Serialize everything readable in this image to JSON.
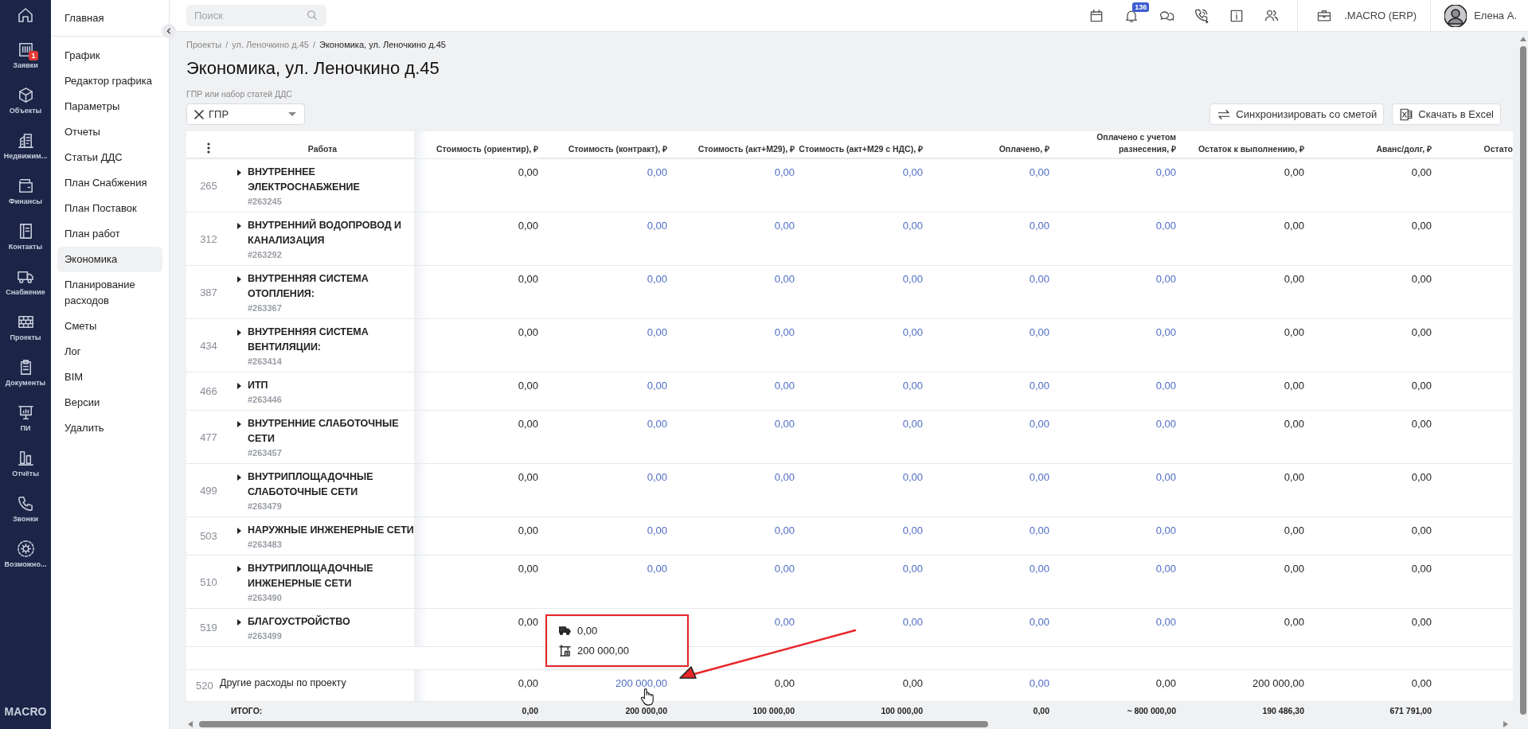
{
  "rail": {
    "items": [
      {
        "label": "Заявки",
        "badge": "1"
      },
      {
        "label": "Объекты"
      },
      {
        "label": "Недвижим..."
      },
      {
        "label": "Финансы"
      },
      {
        "label": "Контакты"
      },
      {
        "label": "Снабжение"
      },
      {
        "label": "Проекты"
      },
      {
        "label": "Документы"
      },
      {
        "label": "ПИ"
      },
      {
        "label": "Отчёты"
      },
      {
        "label": "Звонки"
      },
      {
        "label": "Возможно..."
      }
    ],
    "brand": "MACRO"
  },
  "sidebar": {
    "title": "Главная",
    "items": [
      {
        "label": "График",
        "selected": false
      },
      {
        "label": "Редактор графика",
        "selected": false
      },
      {
        "label": "Параметры",
        "selected": false
      },
      {
        "label": "Отчеты",
        "selected": false
      },
      {
        "label": "Статьи ДДС",
        "selected": false
      },
      {
        "label": "План Снабжения",
        "selected": false
      },
      {
        "label": "План Поставок",
        "selected": false
      },
      {
        "label": "План работ",
        "selected": false
      },
      {
        "label": "Экономика",
        "selected": true
      },
      {
        "label": "Планирование расходов",
        "selected": false
      },
      {
        "label": "Сметы",
        "selected": false
      },
      {
        "label": "Лог",
        "selected": false
      },
      {
        "label": "BIM",
        "selected": false
      },
      {
        "label": "Версии",
        "selected": false
      },
      {
        "label": "Удалить",
        "selected": false
      }
    ]
  },
  "topbar": {
    "search": {
      "placeholder": "Поиск"
    },
    "notifications_count": "136",
    "company": ".MACRO (ERP)",
    "user": "Елена А."
  },
  "breadcrumbs": [
    "Проекты",
    "ул. Леночкино д.45",
    "Экономика, ул. Леночкино д.45"
  ],
  "breadcrumb_separator": "/",
  "page_title": "Экономика, ул. Леночкино д.45",
  "filter": {
    "label": "ГПР или набор статей ДДС",
    "value": "ГПР"
  },
  "actions": [
    "Синхронизировать со сметой",
    "Скачать в Excel"
  ],
  "table": {
    "columns": [
      "Работа",
      "Стоимость (ориентир), ₽",
      "Стоимость (контракт), ₽",
      "Стоимость (акт+М29), ₽",
      "Стоимость (акт+М29 с НДС), ₽",
      "Оплачено, ₽",
      "Оплачено с учетом разнесения, ₽",
      "Остаток к выполнению, ₽",
      "Аванс/долг, ₽",
      "Остато"
    ],
    "rows": [
      {
        "kind": "group",
        "number": "265",
        "name": "ВНУТРЕННЕЕ ЭЛЕКТРОСНАБЖЕНИЕ",
        "code": "#263245",
        "cells": [
          {
            "value": "0,00",
            "link": false
          },
          {
            "value": "0,00",
            "link": true
          },
          {
            "value": "0,00",
            "link": true
          },
          {
            "value": "0,00",
            "link": true
          },
          {
            "value": "0,00",
            "link": true
          },
          {
            "value": "0,00",
            "link": true
          },
          {
            "value": "0,00",
            "link": false
          },
          {
            "value": "0,00",
            "link": false
          }
        ]
      },
      {
        "kind": "group",
        "number": "312",
        "name": "ВНУТРЕННИЙ ВОДОПРОВОД И КАНАЛИЗАЦИЯ",
        "code": "#263292",
        "cells": [
          {
            "value": "0,00",
            "link": false
          },
          {
            "value": "0,00",
            "link": true
          },
          {
            "value": "0,00",
            "link": true
          },
          {
            "value": "0,00",
            "link": true
          },
          {
            "value": "0,00",
            "link": true
          },
          {
            "value": "0,00",
            "link": true
          },
          {
            "value": "0,00",
            "link": false
          },
          {
            "value": "0,00",
            "link": false
          }
        ]
      },
      {
        "kind": "group",
        "number": "387",
        "name": "ВНУТРЕННЯЯ СИСТЕМА ОТОПЛЕНИЯ:",
        "code": "#263367",
        "cells": [
          {
            "value": "0,00",
            "link": false
          },
          {
            "value": "0,00",
            "link": true
          },
          {
            "value": "0,00",
            "link": true
          },
          {
            "value": "0,00",
            "link": true
          },
          {
            "value": "0,00",
            "link": true
          },
          {
            "value": "0,00",
            "link": true
          },
          {
            "value": "0,00",
            "link": false
          },
          {
            "value": "0,00",
            "link": false
          }
        ]
      },
      {
        "kind": "group",
        "number": "434",
        "name": "ВНУТРЕННЯЯ СИСТЕМА ВЕНТИЛЯЦИИ:",
        "code": "#263414",
        "cells": [
          {
            "value": "0,00",
            "link": false
          },
          {
            "value": "0,00",
            "link": true
          },
          {
            "value": "0,00",
            "link": true
          },
          {
            "value": "0,00",
            "link": true
          },
          {
            "value": "0,00",
            "link": true
          },
          {
            "value": "0,00",
            "link": true
          },
          {
            "value": "0,00",
            "link": false
          },
          {
            "value": "0,00",
            "link": false
          }
        ]
      },
      {
        "kind": "group",
        "number": "466",
        "name": "ИТП",
        "code": "#263446",
        "cells": [
          {
            "value": "0,00",
            "link": false
          },
          {
            "value": "0,00",
            "link": true
          },
          {
            "value": "0,00",
            "link": true
          },
          {
            "value": "0,00",
            "link": true
          },
          {
            "value": "0,00",
            "link": true
          },
          {
            "value": "0,00",
            "link": true
          },
          {
            "value": "0,00",
            "link": false
          },
          {
            "value": "0,00",
            "link": false
          }
        ]
      },
      {
        "kind": "group",
        "number": "477",
        "name": "ВНУТРЕННИЕ СЛАБОТОЧНЫЕ СЕТИ",
        "code": "#263457",
        "cells": [
          {
            "value": "0,00",
            "link": false
          },
          {
            "value": "0,00",
            "link": true
          },
          {
            "value": "0,00",
            "link": true
          },
          {
            "value": "0,00",
            "link": true
          },
          {
            "value": "0,00",
            "link": true
          },
          {
            "value": "0,00",
            "link": true
          },
          {
            "value": "0,00",
            "link": false
          },
          {
            "value": "0,00",
            "link": false
          }
        ]
      },
      {
        "kind": "group",
        "number": "499",
        "name": "ВНУТРИПЛОЩАДОЧНЫЕ СЛАБОТОЧНЫЕ СЕТИ",
        "code": "#263479",
        "cells": [
          {
            "value": "0,00",
            "link": false
          },
          {
            "value": "0,00",
            "link": true
          },
          {
            "value": "0,00",
            "link": true
          },
          {
            "value": "0,00",
            "link": true
          },
          {
            "value": "0,00",
            "link": true
          },
          {
            "value": "0,00",
            "link": true
          },
          {
            "value": "0,00",
            "link": false
          },
          {
            "value": "0,00",
            "link": false
          }
        ]
      },
      {
        "kind": "group",
        "number": "503",
        "name": "НАРУЖНЫЕ ИНЖЕНЕРНЫЕ СЕТИ",
        "code": "#263483",
        "cells": [
          {
            "value": "0,00",
            "link": false
          },
          {
            "value": "0,00",
            "link": true
          },
          {
            "value": "0,00",
            "link": true
          },
          {
            "value": "0,00",
            "link": true
          },
          {
            "value": "0,00",
            "link": true
          },
          {
            "value": "0,00",
            "link": true
          },
          {
            "value": "0,00",
            "link": false
          },
          {
            "value": "0,00",
            "link": false
          }
        ]
      },
      {
        "kind": "group",
        "number": "510",
        "name": "ВНУТРИПЛОЩАДОЧНЫЕ ИНЖЕНЕРНЫЕ СЕТИ",
        "code": "#263490",
        "cells": [
          {
            "value": "0,00",
            "link": false
          },
          {
            "value": "0,00",
            "link": true
          },
          {
            "value": "0,00",
            "link": true
          },
          {
            "value": "0,00",
            "link": true
          },
          {
            "value": "0,00",
            "link": true
          },
          {
            "value": "0,00",
            "link": true
          },
          {
            "value": "0,00",
            "link": false
          },
          {
            "value": "0,00",
            "link": false
          }
        ]
      },
      {
        "kind": "group",
        "number": "519",
        "name": "БЛАГОУСТРОЙСТВО",
        "code": "#263499",
        "cells": [
          {
            "value": "0,00",
            "link": false
          },
          null,
          {
            "value": "0,00",
            "link": true
          },
          {
            "value": "0,00",
            "link": true
          },
          {
            "value": "0,00",
            "link": true
          },
          {
            "value": "0,00",
            "link": true
          },
          {
            "value": "0,00",
            "link": false
          },
          {
            "value": "0,00",
            "link": false
          }
        ]
      },
      {
        "kind": "blank"
      },
      {
        "kind": "item",
        "number": "520",
        "name": "Другие расходы по проекту",
        "cells": [
          {
            "value": "0,00",
            "link": false
          },
          {
            "value": "200 000,00",
            "link": true
          },
          {
            "value": "0,00",
            "link": false
          },
          {
            "value": "0,00",
            "link": false
          },
          {
            "value": "0,00",
            "link": true
          },
          {
            "value": "0,00",
            "link": false
          },
          {
            "value": "200 000,00",
            "link": false
          },
          {
            "value": "0,00",
            "link": false
          }
        ]
      }
    ],
    "total": {
      "label": "ИТОГО:",
      "cells": [
        "0,00",
        "200 000,00",
        "100 000,00",
        "100 000,00",
        "0,00",
        "~ 800 000,00",
        "190 486,30",
        "671 791,00"
      ]
    }
  },
  "tooltip": {
    "lines": [
      "0,00",
      "200 000,00"
    ]
  }
}
